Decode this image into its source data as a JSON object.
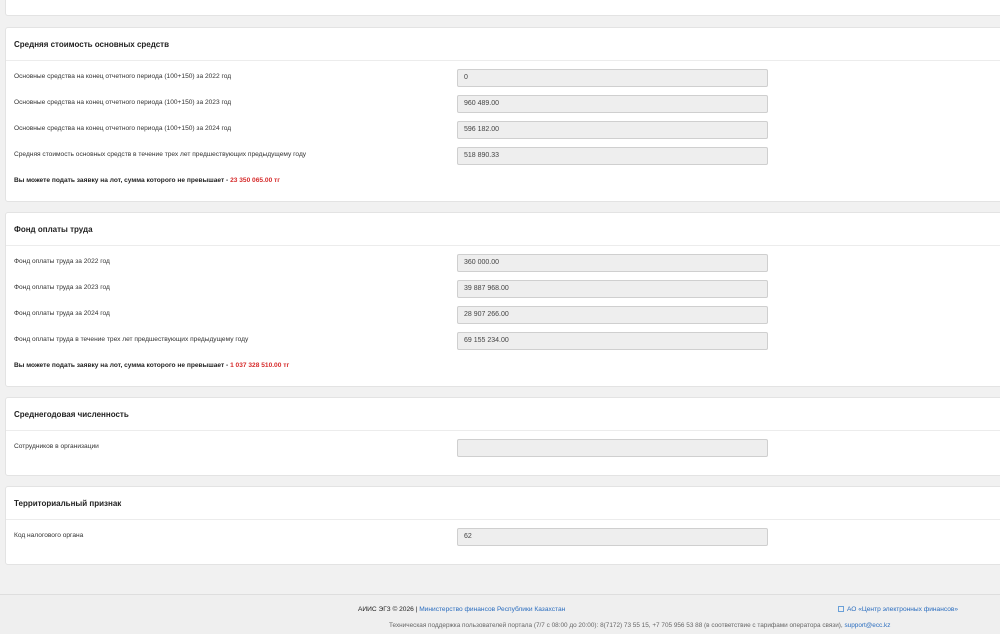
{
  "sections": [
    {
      "title": "Средняя стоимость основных средств",
      "rows": [
        {
          "label": "Основные средства на конец отчетного периода (100+150) за 2022 год",
          "value": "0"
        },
        {
          "label": "Основные средства на конец отчетного периода (100+150) за 2023 год",
          "value": "960 489.00"
        },
        {
          "label": "Основные средства на конец отчетного периода (100+150) за 2024 год",
          "value": "596 182.00"
        },
        {
          "label": "Средняя стоимость основных средств в течение трех лет предшествующих предыдущему году",
          "value": "518 890.33"
        }
      ],
      "note_prefix": "Вы можете подать заявку на лот, сумма которого не превышает - ",
      "note_amount": "23 350 065.00 тг"
    },
    {
      "title": "Фонд оплаты труда",
      "rows": [
        {
          "label": "Фонд оплаты труда за 2022 год",
          "value": "360 000.00"
        },
        {
          "label": "Фонд оплаты труда за 2023 год",
          "value": "39 887 968.00"
        },
        {
          "label": "Фонд оплаты труда за 2024 год",
          "value": "28 907 266.00"
        },
        {
          "label": "Фонд оплаты труда в течение трех лет предшествующих предыдущему году",
          "value": "69 155 234.00"
        }
      ],
      "note_prefix": "Вы можете подать заявку на лот, сумма которого не превышает - ",
      "note_amount": "1 037 328 510.00 тг"
    },
    {
      "title": "Среднегодовая численность",
      "rows": [
        {
          "label": "Сотрудников в организации",
          "value": ""
        }
      ]
    },
    {
      "title": "Территориальный признак",
      "rows": [
        {
          "label": "Код налогового органа",
          "value": "62"
        }
      ]
    }
  ],
  "footer": {
    "copyright": "АИИС ЭГЗ © 2026 | ",
    "ministry_link": "Министерство финансов Республики Казахстан",
    "support_prefix": "Техническая поддержка пользователей портала (7/7 с 08:00 до 20:00): 8(7172) 73 55 15, +7 705 956 53 88 (в соответствие с тарифами оператора связи), ",
    "support_email": "support@ecc.kz",
    "ecc_link": "АО «Центр электронных финансов»",
    "ecc_icon": "external-link-icon"
  },
  "colors": {
    "accent_red": "#d62b2b",
    "link_blue": "#2a6dbf"
  }
}
